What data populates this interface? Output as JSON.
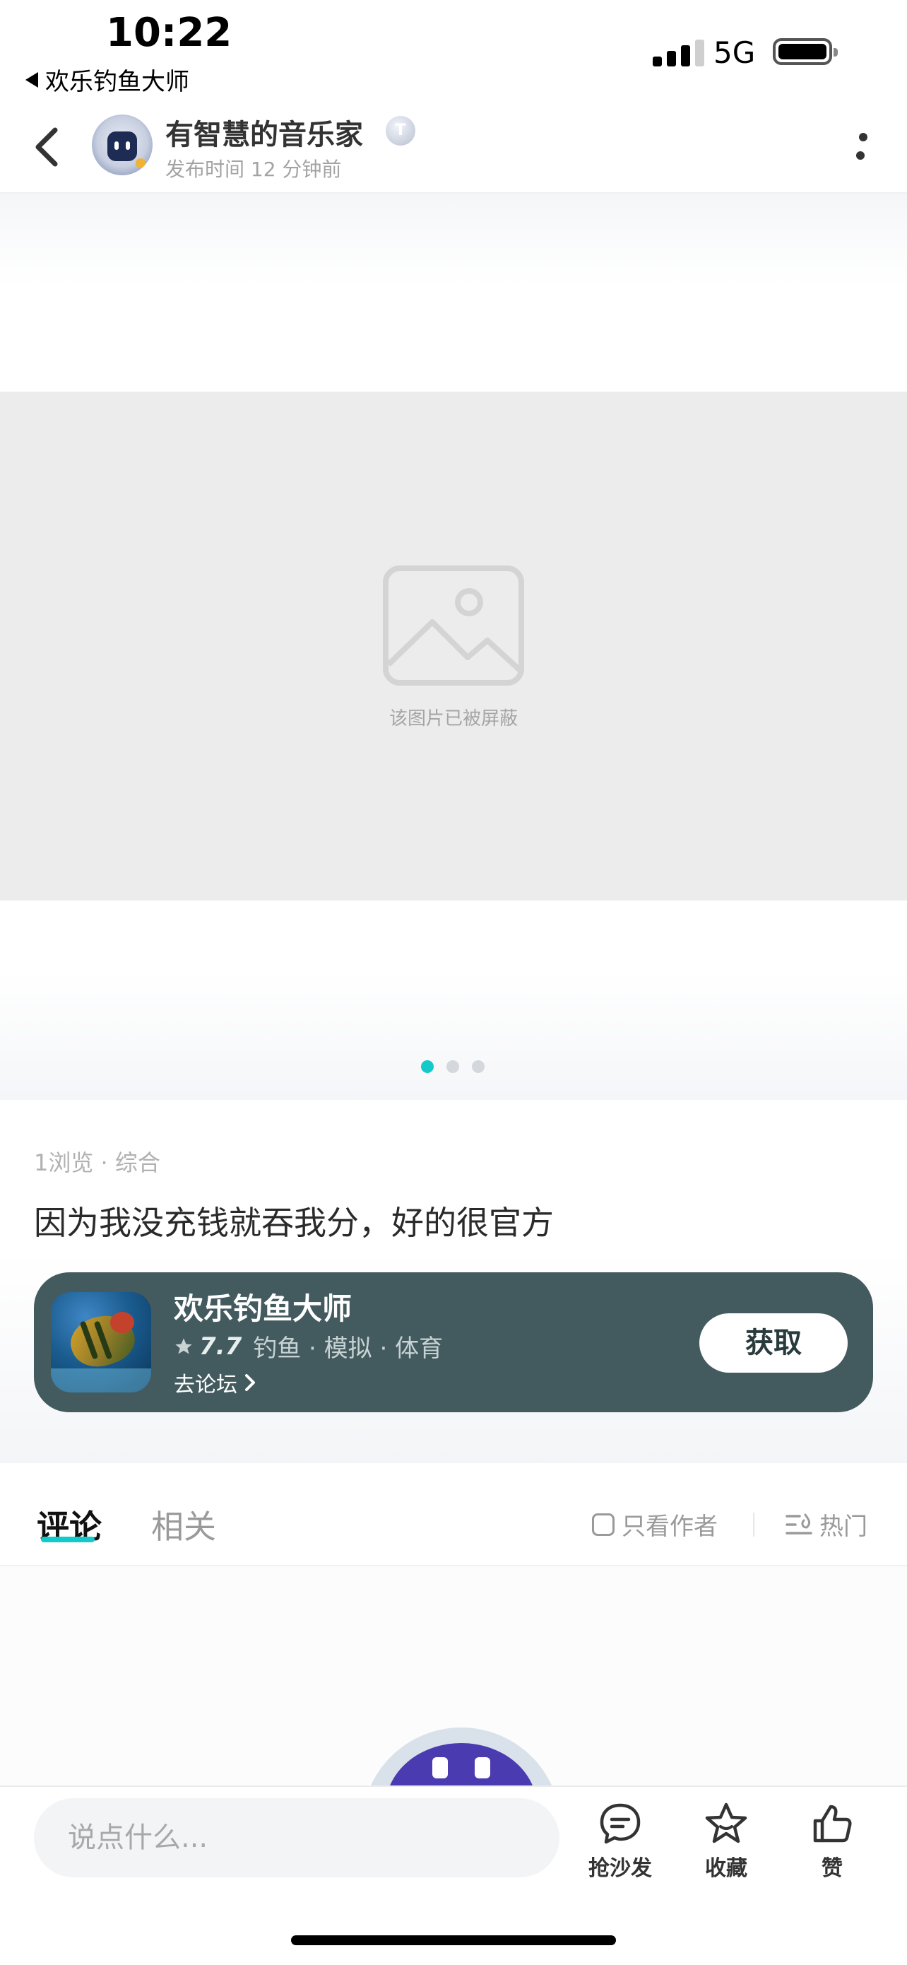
{
  "status_bar": {
    "time": "10:22",
    "back_app": "欢乐钓鱼大师",
    "network": "5G"
  },
  "header": {
    "author": "有智慧的音乐家",
    "badge": "T",
    "post_time": "发布时间 12 分钟前"
  },
  "image": {
    "blocked_text": "该图片已被屏蔽",
    "page_count": 3,
    "active_page": 1
  },
  "post": {
    "meta": "1浏览 · 综合",
    "title": "因为我没充钱就吞我分，好的很官方"
  },
  "app_card": {
    "name": "欢乐钓鱼大师",
    "rating": "7.7",
    "categories": "钓鱼 · 模拟 · 体育",
    "forum_link": "去论坛",
    "get_button": "获取"
  },
  "tabs": {
    "comments": "评论",
    "related": "相关",
    "only_author": "只看作者",
    "sort": "热门"
  },
  "bottom_bar": {
    "input_placeholder": "说点什么...",
    "sofa": "抢沙发",
    "favorite": "收藏",
    "like": "赞"
  },
  "colors": {
    "accent": "#14c9c9",
    "card_bg": "#435a5e"
  }
}
